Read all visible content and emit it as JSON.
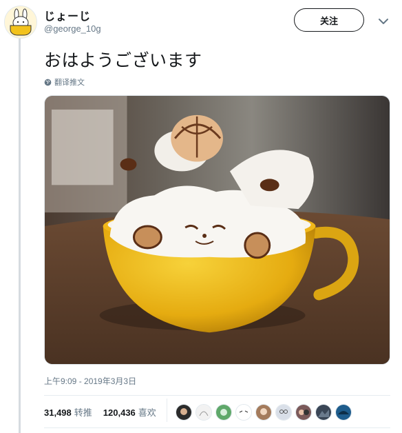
{
  "user": {
    "display_name": "じょーじ",
    "handle": "@george_10g",
    "avatar_icon": "bunny-in-cup-avatar"
  },
  "follow_button": {
    "label": "关注"
  },
  "more_icon": "chevron-down-icon",
  "tweet": {
    "text": "おはようございます",
    "translate_label": "翻译推文",
    "translate_icon": "globe-icon",
    "media_alt_icon": "latte-art-photo",
    "timestamp": "上午9:09 - 2019年3月3日"
  },
  "stats": {
    "retweets": {
      "count": "31,498",
      "label": "转推"
    },
    "likes": {
      "count": "120,436",
      "label": "喜欢"
    }
  },
  "liker_avatars": [
    {
      "icon": "avatar-dark",
      "color": "#2b2b2b"
    },
    {
      "icon": "avatar-sketch",
      "color": "#f2f2f2"
    },
    {
      "icon": "avatar-green",
      "color": "#5fa86a"
    },
    {
      "icon": "avatar-face",
      "color": "#ffffff"
    },
    {
      "icon": "avatar-brown",
      "color": "#a47b5c"
    },
    {
      "icon": "avatar-glasses",
      "color": "#d9dfe8"
    },
    {
      "icon": "avatar-mixed",
      "color": "#7b5a5a"
    },
    {
      "icon": "avatar-night",
      "color": "#3a4656"
    },
    {
      "icon": "avatar-blue",
      "color": "#1e5c8c"
    }
  ],
  "colors": {
    "text": "#14171a",
    "muted": "#657786",
    "border": "#e1e8ed",
    "cup": "#e8b416",
    "foam": "#f6f4f0"
  }
}
